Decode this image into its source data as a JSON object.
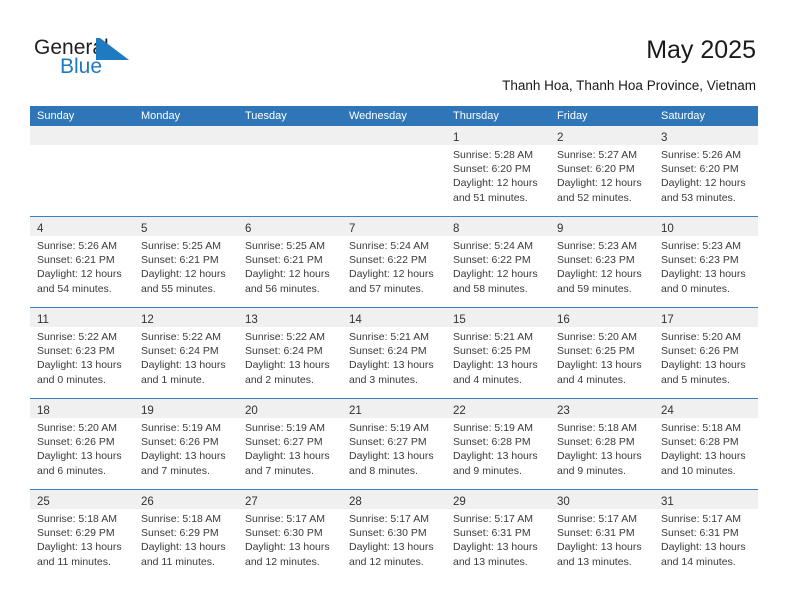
{
  "brand": {
    "name_part1": "General",
    "name_part2": "Blue"
  },
  "header": {
    "title": "May 2025",
    "location": "Thanh Hoa, Thanh Hoa Province, Vietnam"
  },
  "colors": {
    "header_blue": "#2e76b8",
    "brand_blue": "#1f7ac0",
    "daynum_band": "#f0f0f0",
    "week_divider": "#3f7fbf"
  },
  "calendar": {
    "weekdays": [
      "Sunday",
      "Monday",
      "Tuesday",
      "Wednesday",
      "Thursday",
      "Friday",
      "Saturday"
    ],
    "weeks": [
      [
        {
          "day": "",
          "empty": true
        },
        {
          "day": "",
          "empty": true
        },
        {
          "day": "",
          "empty": true
        },
        {
          "day": "",
          "empty": true
        },
        {
          "day": "1",
          "sunrise": "Sunrise: 5:28 AM",
          "sunset": "Sunset: 6:20 PM",
          "daylight": "Daylight: 12 hours and 51 minutes."
        },
        {
          "day": "2",
          "sunrise": "Sunrise: 5:27 AM",
          "sunset": "Sunset: 6:20 PM",
          "daylight": "Daylight: 12 hours and 52 minutes."
        },
        {
          "day": "3",
          "sunrise": "Sunrise: 5:26 AM",
          "sunset": "Sunset: 6:20 PM",
          "daylight": "Daylight: 12 hours and 53 minutes."
        }
      ],
      [
        {
          "day": "4",
          "sunrise": "Sunrise: 5:26 AM",
          "sunset": "Sunset: 6:21 PM",
          "daylight": "Daylight: 12 hours and 54 minutes."
        },
        {
          "day": "5",
          "sunrise": "Sunrise: 5:25 AM",
          "sunset": "Sunset: 6:21 PM",
          "daylight": "Daylight: 12 hours and 55 minutes."
        },
        {
          "day": "6",
          "sunrise": "Sunrise: 5:25 AM",
          "sunset": "Sunset: 6:21 PM",
          "daylight": "Daylight: 12 hours and 56 minutes."
        },
        {
          "day": "7",
          "sunrise": "Sunrise: 5:24 AM",
          "sunset": "Sunset: 6:22 PM",
          "daylight": "Daylight: 12 hours and 57 minutes."
        },
        {
          "day": "8",
          "sunrise": "Sunrise: 5:24 AM",
          "sunset": "Sunset: 6:22 PM",
          "daylight": "Daylight: 12 hours and 58 minutes."
        },
        {
          "day": "9",
          "sunrise": "Sunrise: 5:23 AM",
          "sunset": "Sunset: 6:23 PM",
          "daylight": "Daylight: 12 hours and 59 minutes."
        },
        {
          "day": "10",
          "sunrise": "Sunrise: 5:23 AM",
          "sunset": "Sunset: 6:23 PM",
          "daylight": "Daylight: 13 hours and 0 minutes."
        }
      ],
      [
        {
          "day": "11",
          "sunrise": "Sunrise: 5:22 AM",
          "sunset": "Sunset: 6:23 PM",
          "daylight": "Daylight: 13 hours and 0 minutes."
        },
        {
          "day": "12",
          "sunrise": "Sunrise: 5:22 AM",
          "sunset": "Sunset: 6:24 PM",
          "daylight": "Daylight: 13 hours and 1 minute."
        },
        {
          "day": "13",
          "sunrise": "Sunrise: 5:22 AM",
          "sunset": "Sunset: 6:24 PM",
          "daylight": "Daylight: 13 hours and 2 minutes."
        },
        {
          "day": "14",
          "sunrise": "Sunrise: 5:21 AM",
          "sunset": "Sunset: 6:24 PM",
          "daylight": "Daylight: 13 hours and 3 minutes."
        },
        {
          "day": "15",
          "sunrise": "Sunrise: 5:21 AM",
          "sunset": "Sunset: 6:25 PM",
          "daylight": "Daylight: 13 hours and 4 minutes."
        },
        {
          "day": "16",
          "sunrise": "Sunrise: 5:20 AM",
          "sunset": "Sunset: 6:25 PM",
          "daylight": "Daylight: 13 hours and 4 minutes."
        },
        {
          "day": "17",
          "sunrise": "Sunrise: 5:20 AM",
          "sunset": "Sunset: 6:26 PM",
          "daylight": "Daylight: 13 hours and 5 minutes."
        }
      ],
      [
        {
          "day": "18",
          "sunrise": "Sunrise: 5:20 AM",
          "sunset": "Sunset: 6:26 PM",
          "daylight": "Daylight: 13 hours and 6 minutes."
        },
        {
          "day": "19",
          "sunrise": "Sunrise: 5:19 AM",
          "sunset": "Sunset: 6:26 PM",
          "daylight": "Daylight: 13 hours and 7 minutes."
        },
        {
          "day": "20",
          "sunrise": "Sunrise: 5:19 AM",
          "sunset": "Sunset: 6:27 PM",
          "daylight": "Daylight: 13 hours and 7 minutes."
        },
        {
          "day": "21",
          "sunrise": "Sunrise: 5:19 AM",
          "sunset": "Sunset: 6:27 PM",
          "daylight": "Daylight: 13 hours and 8 minutes."
        },
        {
          "day": "22",
          "sunrise": "Sunrise: 5:19 AM",
          "sunset": "Sunset: 6:28 PM",
          "daylight": "Daylight: 13 hours and 9 minutes."
        },
        {
          "day": "23",
          "sunrise": "Sunrise: 5:18 AM",
          "sunset": "Sunset: 6:28 PM",
          "daylight": "Daylight: 13 hours and 9 minutes."
        },
        {
          "day": "24",
          "sunrise": "Sunrise: 5:18 AM",
          "sunset": "Sunset: 6:28 PM",
          "daylight": "Daylight: 13 hours and 10 minutes."
        }
      ],
      [
        {
          "day": "25",
          "sunrise": "Sunrise: 5:18 AM",
          "sunset": "Sunset: 6:29 PM",
          "daylight": "Daylight: 13 hours and 11 minutes."
        },
        {
          "day": "26",
          "sunrise": "Sunrise: 5:18 AM",
          "sunset": "Sunset: 6:29 PM",
          "daylight": "Daylight: 13 hours and 11 minutes."
        },
        {
          "day": "27",
          "sunrise": "Sunrise: 5:17 AM",
          "sunset": "Sunset: 6:30 PM",
          "daylight": "Daylight: 13 hours and 12 minutes."
        },
        {
          "day": "28",
          "sunrise": "Sunrise: 5:17 AM",
          "sunset": "Sunset: 6:30 PM",
          "daylight": "Daylight: 13 hours and 12 minutes."
        },
        {
          "day": "29",
          "sunrise": "Sunrise: 5:17 AM",
          "sunset": "Sunset: 6:31 PM",
          "daylight": "Daylight: 13 hours and 13 minutes."
        },
        {
          "day": "30",
          "sunrise": "Sunrise: 5:17 AM",
          "sunset": "Sunset: 6:31 PM",
          "daylight": "Daylight: 13 hours and 13 minutes."
        },
        {
          "day": "31",
          "sunrise": "Sunrise: 5:17 AM",
          "sunset": "Sunset: 6:31 PM",
          "daylight": "Daylight: 13 hours and 14 minutes."
        }
      ]
    ]
  }
}
